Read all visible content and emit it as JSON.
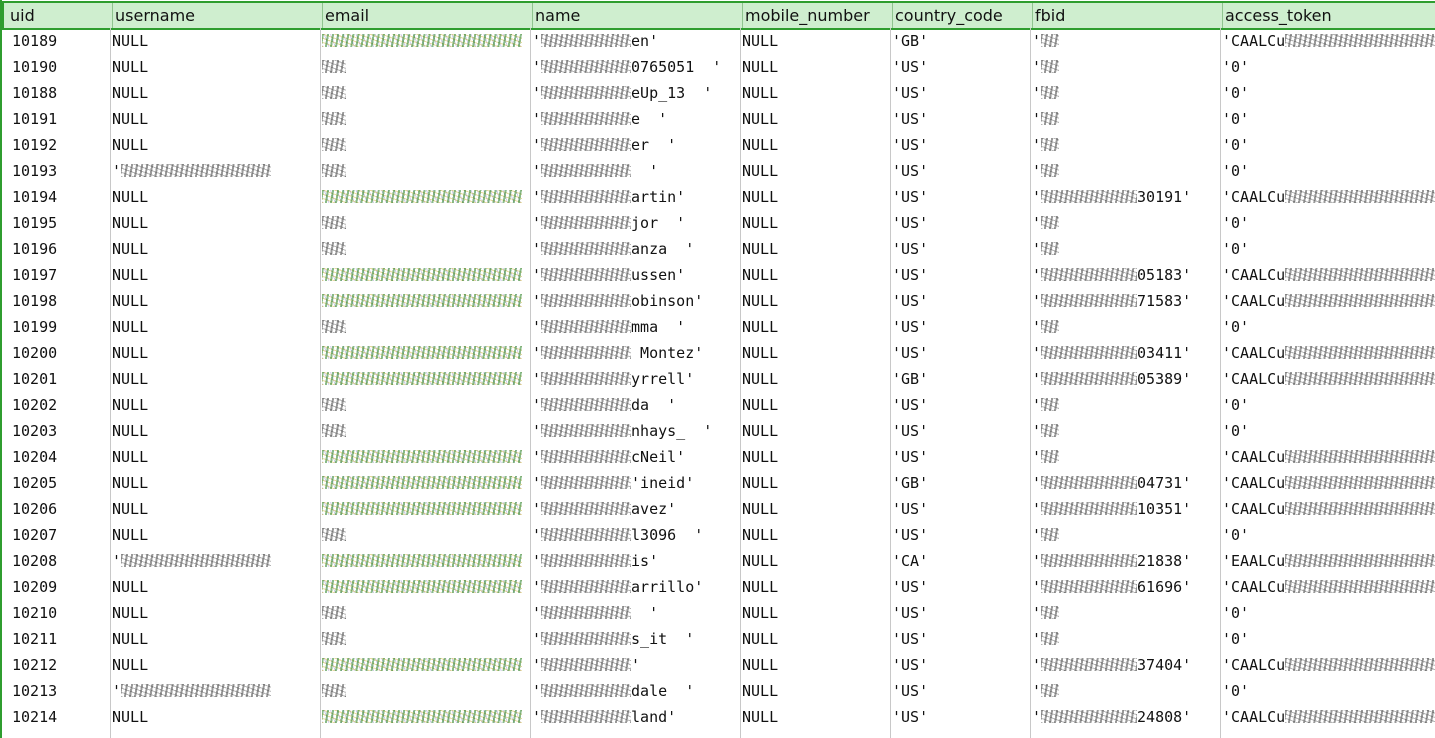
{
  "columns": [
    "uid",
    "username",
    "email",
    "name",
    "mobile_number",
    "country_code",
    "fbid",
    "access_token"
  ],
  "rows": [
    {
      "uid": "10189",
      "username": "NULL",
      "email": "",
      "name": "'",
      "name_tail": "en'",
      "mobile": "NULL",
      "cc": "'GB'",
      "fbid": "'",
      "fbid_tail": "",
      "token": "'CAALCu"
    },
    {
      "uid": "10190",
      "username": "NULL",
      "email": "",
      "name": "'",
      "name_tail": "0765051  '",
      "mobile": "NULL",
      "cc": "'US'",
      "fbid": "'",
      "fbid_tail": "",
      "token": "'0'"
    },
    {
      "uid": "10188",
      "username": "NULL",
      "email": "",
      "name": "'",
      "name_tail": "eUp_13  '",
      "mobile": "NULL",
      "cc": "'US'",
      "fbid": "'",
      "fbid_tail": "",
      "token": "'0'"
    },
    {
      "uid": "10191",
      "username": "NULL",
      "email": "",
      "name": "'",
      "name_tail": "e  '",
      "mobile": "NULL",
      "cc": "'US'",
      "fbid": "'",
      "fbid_tail": "",
      "token": "'0'"
    },
    {
      "uid": "10192",
      "username": "NULL",
      "email": "",
      "name": "'",
      "name_tail": "er  '",
      "mobile": "NULL",
      "cc": "'US'",
      "fbid": "'",
      "fbid_tail": "",
      "token": "'0'"
    },
    {
      "uid": "10193",
      "username": "'",
      "email": "",
      "name": "'",
      "name_tail": "  '",
      "mobile": "NULL",
      "cc": "'US'",
      "fbid": "'",
      "fbid_tail": "",
      "token": "'0'"
    },
    {
      "uid": "10194",
      "username": "NULL",
      "email": "",
      "name": "'",
      "name_tail": "artin'",
      "mobile": "NULL",
      "cc": "'US'",
      "fbid": "'",
      "fbid_tail": "30191'",
      "token": "'CAALCu"
    },
    {
      "uid": "10195",
      "username": "NULL",
      "email": "",
      "name": "'",
      "name_tail": "jor  '",
      "mobile": "NULL",
      "cc": "'US'",
      "fbid": "'",
      "fbid_tail": "",
      "token": "'0'"
    },
    {
      "uid": "10196",
      "username": "NULL",
      "email": "",
      "name": "'",
      "name_tail": "anza  '",
      "mobile": "NULL",
      "cc": "'US'",
      "fbid": "'",
      "fbid_tail": "",
      "token": "'0'"
    },
    {
      "uid": "10197",
      "username": "NULL",
      "email": "",
      "name": "'",
      "name_tail": "ussen'",
      "mobile": "NULL",
      "cc": "'US'",
      "fbid": "'",
      "fbid_tail": "05183'",
      "token": "'CAALCu"
    },
    {
      "uid": "10198",
      "username": "NULL",
      "email": "",
      "name": "'",
      "name_tail": "obinson'",
      "mobile": "NULL",
      "cc": "'US'",
      "fbid": "'",
      "fbid_tail": "71583'",
      "token": "'CAALCu"
    },
    {
      "uid": "10199",
      "username": "NULL",
      "email": "",
      "name": "'",
      "name_tail": "mma  '",
      "mobile": "NULL",
      "cc": "'US'",
      "fbid": "'",
      "fbid_tail": "",
      "token": "'0'"
    },
    {
      "uid": "10200",
      "username": "NULL",
      "email": "",
      "name": "'",
      "name_tail": " Montez'",
      "mobile": "NULL",
      "cc": "'US'",
      "fbid": "'",
      "fbid_tail": "03411'",
      "token": "'CAALCu"
    },
    {
      "uid": "10201",
      "username": "NULL",
      "email": "",
      "name": "'",
      "name_tail": "yrrell'",
      "mobile": "NULL",
      "cc": "'GB'",
      "fbid": "'",
      "fbid_tail": "05389'",
      "token": "'CAALCu"
    },
    {
      "uid": "10202",
      "username": "NULL",
      "email": "",
      "name": "'",
      "name_tail": "da  '",
      "mobile": "NULL",
      "cc": "'US'",
      "fbid": "'",
      "fbid_tail": "",
      "token": "'0'"
    },
    {
      "uid": "10203",
      "username": "NULL",
      "email": "",
      "name": "'",
      "name_tail": "nhays_  '",
      "mobile": "NULL",
      "cc": "'US'",
      "fbid": "'",
      "fbid_tail": "",
      "token": "'0'"
    },
    {
      "uid": "10204",
      "username": "NULL",
      "email": "",
      "name": "'",
      "name_tail": "cNeil'",
      "mobile": "NULL",
      "cc": "'US'",
      "fbid": "'",
      "fbid_tail": "",
      "token": "'CAALCu"
    },
    {
      "uid": "10205",
      "username": "NULL",
      "email": "",
      "name": "'",
      "name_tail": "'ineid'",
      "mobile": "NULL",
      "cc": "'GB'",
      "fbid": "'",
      "fbid_tail": "04731'",
      "token": "'CAALCu"
    },
    {
      "uid": "10206",
      "username": "NULL",
      "email": "",
      "name": "'",
      "name_tail": "avez'",
      "mobile": "NULL",
      "cc": "'US'",
      "fbid": "'",
      "fbid_tail": "10351'",
      "token": "'CAALCu"
    },
    {
      "uid": "10207",
      "username": "NULL",
      "email": "",
      "name": "'",
      "name_tail": "l3096  '",
      "mobile": "NULL",
      "cc": "'US'",
      "fbid": "'",
      "fbid_tail": "",
      "token": "'0'"
    },
    {
      "uid": "10208",
      "username": "'",
      "email": "",
      "name": "'",
      "name_tail": "is'",
      "mobile": "NULL",
      "cc": "'CA'",
      "fbid": "'",
      "fbid_tail": "21838'",
      "token": "'EAALCu"
    },
    {
      "uid": "10209",
      "username": "NULL",
      "email": "",
      "name": "'",
      "name_tail": "arrillo'",
      "mobile": "NULL",
      "cc": "'US'",
      "fbid": "'",
      "fbid_tail": "61696'",
      "token": "'CAALCu"
    },
    {
      "uid": "10210",
      "username": "NULL",
      "email": "",
      "name": "'",
      "name_tail": "  '",
      "mobile": "NULL",
      "cc": "'US'",
      "fbid": "'",
      "fbid_tail": "",
      "token": "'0'"
    },
    {
      "uid": "10211",
      "username": "NULL",
      "email": "",
      "name": "'",
      "name_tail": "s_it  '",
      "mobile": "NULL",
      "cc": "'US'",
      "fbid": "'",
      "fbid_tail": "",
      "token": "'0'"
    },
    {
      "uid": "10212",
      "username": "NULL",
      "email": "",
      "name": "'",
      "name_tail": "'",
      "mobile": "NULL",
      "cc": "'US'",
      "fbid": "'",
      "fbid_tail": "37404'",
      "token": "'CAALCu"
    },
    {
      "uid": "10213",
      "username": "'",
      "email": "",
      "name": "'",
      "name_tail": "dale  '",
      "mobile": "NULL",
      "cc": "'US'",
      "fbid": "'",
      "fbid_tail": "",
      "token": "'0'"
    },
    {
      "uid": "10214",
      "username": "NULL",
      "email": "",
      "name": "'",
      "name_tail": "land'",
      "mobile": "NULL",
      "cc": "'US'",
      "fbid": "'",
      "fbid_tail": "24808'",
      "token": "'CAALCu"
    }
  ]
}
